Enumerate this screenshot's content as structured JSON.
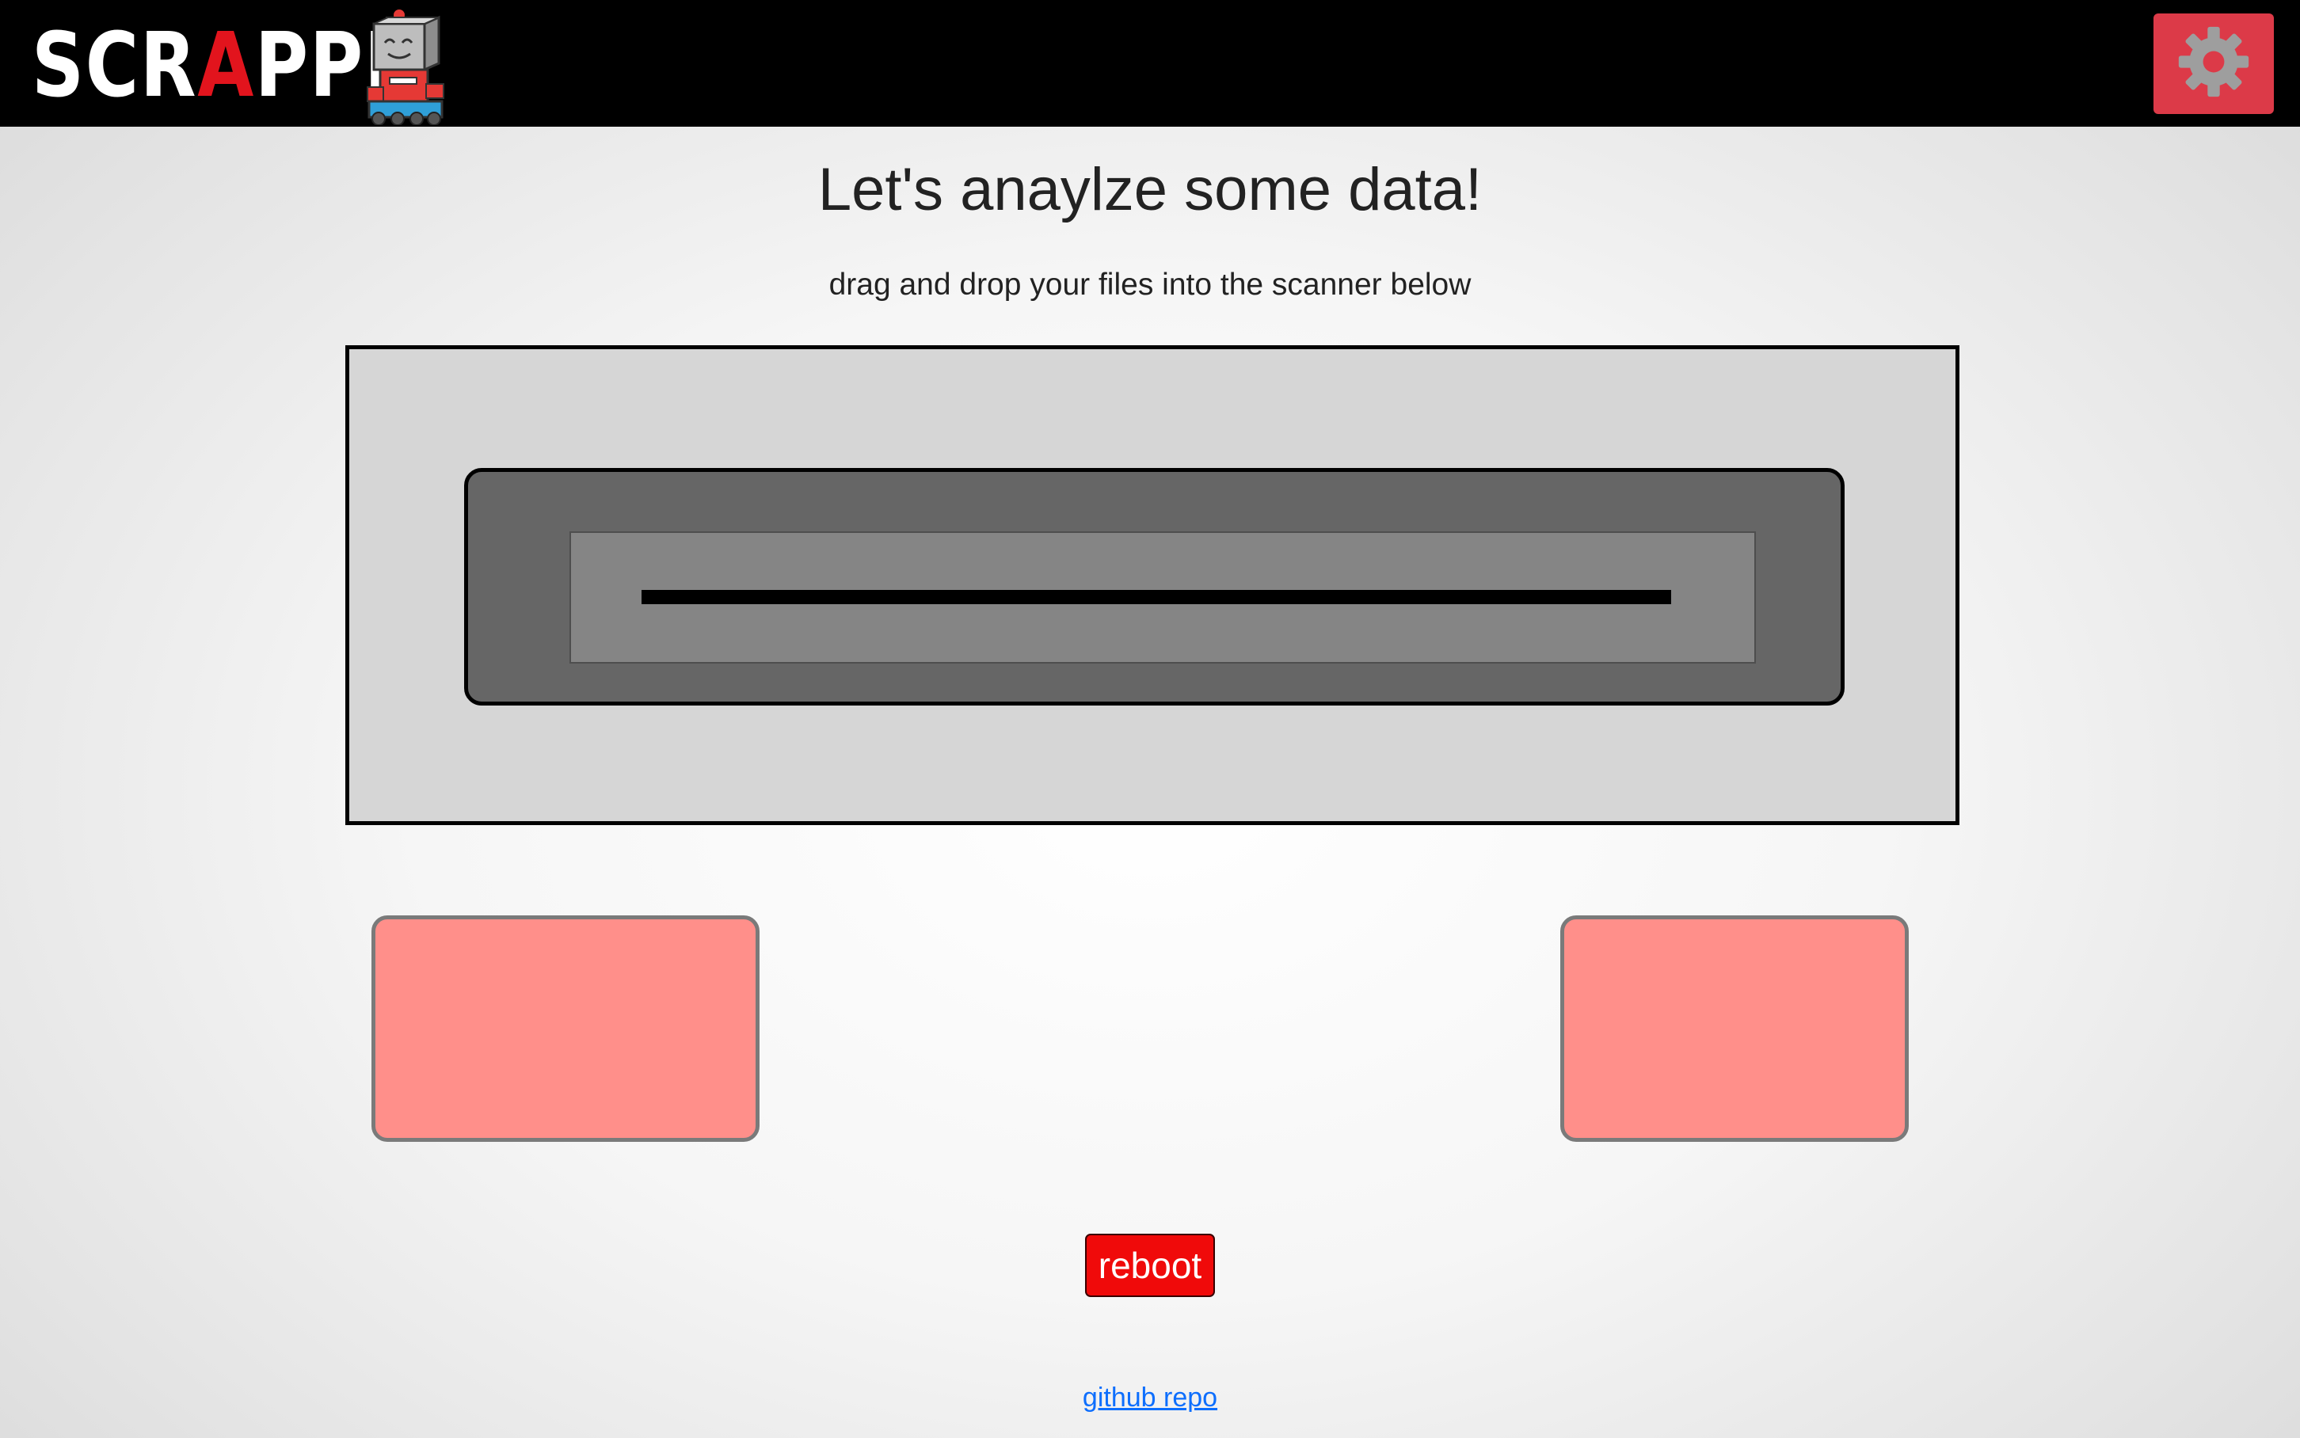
{
  "header": {
    "logo": {
      "text_before": "SCR",
      "text_accent": "A",
      "text_after": "PPI",
      "accent_color": "#e2141d",
      "robot_icon": "robot-mascot-icon"
    },
    "settings_icon": "gear-icon",
    "settings_color": "#dc3a48"
  },
  "main": {
    "title": "Let's anaylze some data!",
    "subtitle": "drag and drop your files into the scanner below"
  },
  "cards": {
    "left_color": "#ff8f8a",
    "right_color": "#ff8f8a"
  },
  "actions": {
    "reboot_label": "reboot",
    "reboot_color": "#f00a0a"
  },
  "footer": {
    "link_label": "github repo"
  }
}
